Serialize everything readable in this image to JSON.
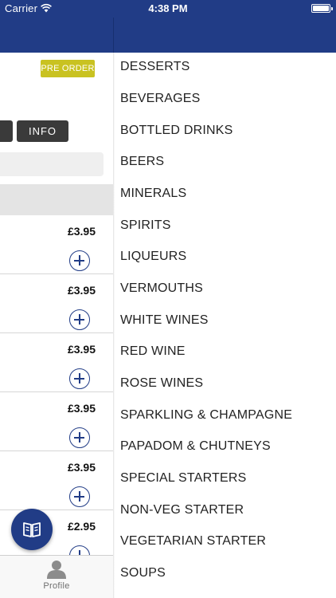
{
  "status": {
    "carrier": "Carrier",
    "time": "4:38 PM"
  },
  "left_panel": {
    "preorder_label": "PRE ORDER",
    "info_label": "INFO",
    "items": [
      {
        "price": "£3.95"
      },
      {
        "price": "£3.95"
      },
      {
        "price": "£3.95"
      },
      {
        "price": "£3.95"
      },
      {
        "price": "£3.95"
      },
      {
        "price": "£2.95"
      }
    ],
    "tab_profile_label": "Profile"
  },
  "menu": {
    "categories": [
      "DESSERTS",
      "BEVERAGES",
      "BOTTLED DRINKS",
      "BEERS",
      "MINERALS",
      "SPIRITS",
      "LIQUEURS",
      "VERMOUTHS",
      "WHITE WINES",
      "RED WINE",
      "ROSE WINES",
      "SPARKLING & CHAMPAGNE",
      "PAPADOM & CHUTNEYS",
      "SPECIAL STARTERS",
      "NON-VEG STARTER",
      "VEGETARIAN STARTER",
      "SOUPS"
    ]
  },
  "colors": {
    "brand_blue": "#213c86",
    "preorder_yellow": "#c9c221",
    "button_dark": "#3a3a3a"
  },
  "icons": [
    "wifi-icon",
    "battery-icon",
    "add-icon",
    "menu-book-icon",
    "profile-icon"
  ]
}
